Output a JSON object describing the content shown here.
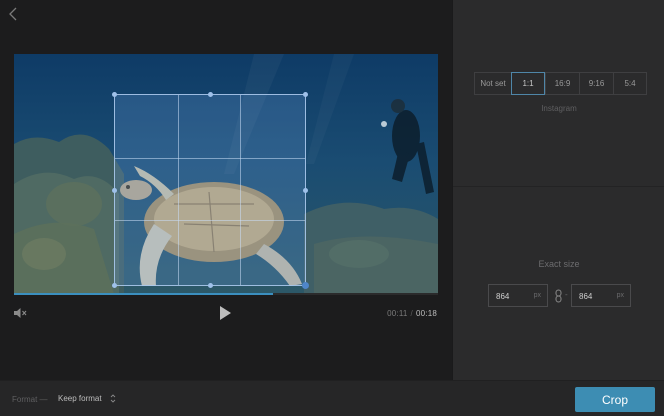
{
  "editor": {
    "video": {
      "current_time": "00:11",
      "separator": "/",
      "duration": "00:18",
      "progress": 0.61
    }
  },
  "sidebar": {
    "aspect_options": [
      {
        "label": "Not set",
        "active": false
      },
      {
        "label": "1:1",
        "active": true
      },
      {
        "label": "16:9",
        "active": false
      },
      {
        "label": "9:16",
        "active": false
      },
      {
        "label": "5:4",
        "active": false
      }
    ],
    "preset_label": "Instagram",
    "exact_size_label": "Exact size",
    "width": {
      "value": "864",
      "unit": "px"
    },
    "link_dash": "-",
    "height": {
      "value": "864",
      "unit": "px"
    }
  },
  "bottom": {
    "format_label": "Format —",
    "format_value": "Keep format",
    "crop_label": "Crop"
  },
  "colors": {
    "accent": "#3d8db3",
    "panel": "#2b2b2c",
    "background": "#1c1c1d"
  }
}
